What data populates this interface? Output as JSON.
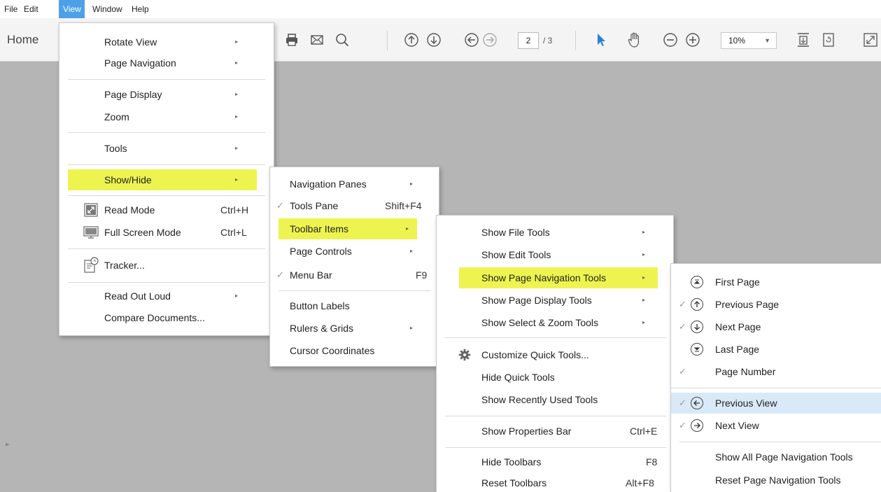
{
  "menubar": {
    "items": [
      "File",
      "Edit",
      "View",
      "Window",
      "Help"
    ]
  },
  "toolbar": {
    "home_tab": "Home",
    "page_current": "2",
    "page_total": "/ 3",
    "zoom": "10%"
  },
  "view_menu": {
    "items": [
      {
        "label": "Rotate View",
        "submenu": true
      },
      {
        "label": "Page Navigation",
        "submenu": true
      },
      {
        "label": "Page Display",
        "submenu": true
      },
      {
        "label": "Zoom",
        "submenu": true
      },
      {
        "label": "Tools",
        "submenu": true
      },
      {
        "label": "Show/Hide",
        "submenu": true,
        "highlighted": true
      },
      {
        "label": "Read Mode",
        "shortcut": "Ctrl+H",
        "icon": "read-mode-icon"
      },
      {
        "label": "Full Screen Mode",
        "shortcut": "Ctrl+L",
        "icon": "full-screen-icon"
      },
      {
        "label": "Tracker...",
        "icon": "tracker-icon"
      },
      {
        "label": "Read Out Loud",
        "submenu": true
      },
      {
        "label": "Compare Documents..."
      }
    ]
  },
  "showhide_menu": {
    "items": [
      {
        "label": "Navigation Panes",
        "submenu": true
      },
      {
        "label": "Tools Pane",
        "shortcut": "Shift+F4",
        "checked": true
      },
      {
        "label": "Toolbar Items",
        "submenu": true,
        "highlighted": true
      },
      {
        "label": "Page Controls",
        "submenu": true
      },
      {
        "label": "Menu Bar",
        "shortcut": "F9",
        "checked": true
      },
      {
        "label": "Button Labels"
      },
      {
        "label": "Rulers & Grids",
        "submenu": true
      },
      {
        "label": "Cursor Coordinates"
      }
    ]
  },
  "toolbar_items_menu": {
    "items": [
      {
        "label": "Show File Tools",
        "submenu": true
      },
      {
        "label": "Show Edit Tools",
        "submenu": true
      },
      {
        "label": "Show Page Navigation Tools",
        "submenu": true,
        "highlighted": true
      },
      {
        "label": "Show Page Display Tools",
        "submenu": true
      },
      {
        "label": "Show Select & Zoom Tools",
        "submenu": true
      },
      {
        "label": "Customize Quick Tools...",
        "icon": "gear-icon"
      },
      {
        "label": "Hide Quick Tools"
      },
      {
        "label": "Show Recently Used Tools"
      },
      {
        "label": "Show Properties Bar",
        "shortcut": "Ctrl+E"
      },
      {
        "label": "Hide Toolbars",
        "shortcut": "F8"
      },
      {
        "label": "Reset Toolbars",
        "shortcut": "Alt+F8"
      }
    ]
  },
  "page_nav_menu": {
    "items": [
      {
        "label": "First Page",
        "checked": false,
        "icon": "first-page-icon"
      },
      {
        "label": "Previous Page",
        "checked": true,
        "icon": "previous-page-icon"
      },
      {
        "label": "Next Page",
        "checked": true,
        "icon": "next-page-icon"
      },
      {
        "label": "Last Page",
        "checked": false,
        "icon": "last-page-icon"
      },
      {
        "label": "Page Number",
        "checked": true
      },
      {
        "label": "Previous View",
        "checked": true,
        "icon": "previous-view-icon",
        "highlighted": true
      },
      {
        "label": "Next View",
        "checked": true,
        "icon": "next-view-icon"
      },
      {
        "label": "Show All Page Navigation Tools"
      },
      {
        "label": "Reset Page Navigation Tools"
      }
    ]
  },
  "glyphs": {
    "check": "✓",
    "submenu_arrow": "▸",
    "dropdown_arrow": "▼",
    "panel_arrow": "▸"
  },
  "colors": {
    "menu_highlight_yellow": "#eef44f",
    "menu_hover_blue": "#d9e9f8",
    "active_menubar": "#4da0e8",
    "select_arrow_blue": "#2a7fd8"
  }
}
